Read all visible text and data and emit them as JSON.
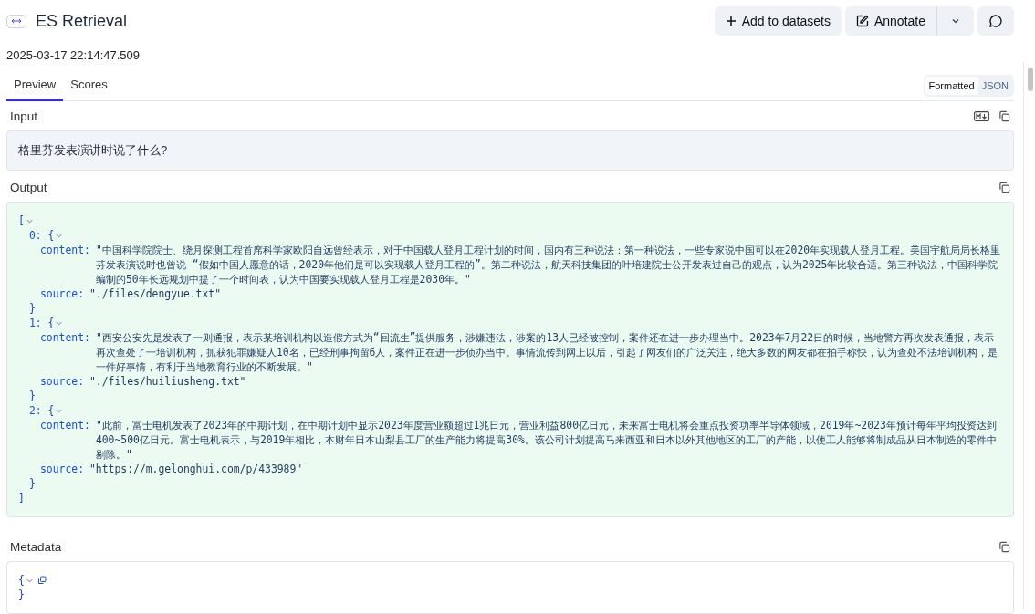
{
  "header": {
    "title": "ES Retrieval",
    "timestamp": "2025-03-17 22:14:47.509",
    "buttons": [
      {
        "kind": "add",
        "label": "Add to datasets"
      },
      {
        "kind": "annotate",
        "label": "Annotate"
      },
      {
        "kind": "dropdown"
      },
      {
        "kind": "comment"
      }
    ]
  },
  "tabs": [
    {
      "label": "Preview",
      "selected": true
    },
    {
      "label": "Scores",
      "selected": false
    }
  ],
  "view_toggle": [
    {
      "label": "Formatted",
      "selected": true
    },
    {
      "label": "JSON",
      "selected": false
    }
  ],
  "input": {
    "label": "Input",
    "text": "格里芬发表演讲时说了什么?"
  },
  "output": {
    "label": "Output",
    "open": "[",
    "close": "]",
    "items": [
      {
        "key": "0:",
        "open": "{",
        "close": "}",
        "fields": [
          {
            "key": "content:",
            "value": "\"中国科学院院士、绕月探测工程首席科学家欧阳自远曾经表示，对于中国载人登月工程计划的时间，国内有三种说法：第一种说法，一些专家说中国可以在2020年实现载人登月工程。美国宇航局局长格里芬发表演说时也曾说 “假如中国人愿意的话，2020年他们是可以实现载人登月工程的”。第二种说法，航天科技集团的叶培建院士公开发表过自己的观点，认为2025年比较合适。第三种说法，中国科学院编制的50年长远规划中提了一个时间表，认为中国要实现载人登月工程是2030年。\""
          },
          {
            "key": "source:",
            "value": "\"./files/dengyue.txt\""
          }
        ]
      },
      {
        "key": "1:",
        "open": "{",
        "close": "}",
        "fields": [
          {
            "key": "content:",
            "value": "\"西安公安先是发表了一则通报，表示某培训机构以造假方式为“回流生”提供服务，涉嫌违法，涉案的13人已经被控制，案件还在进一步办理当中。2023年7月22日的时候，当地警方再次发表通报，表示再次查处了一培训机构，抓获犯罪嫌疑人10名，已经刑事拘留6人，案件正在进一步侦办当中。事情流传到网上以后，引起了网友们的广泛关注，绝大多数的网友都在拍手称快，认为查处不法培训机构，是一件好事情，有利于当地教育行业的不断发展。\""
          },
          {
            "key": "source:",
            "value": "\"./files/huiliusheng.txt\""
          }
        ]
      },
      {
        "key": "2:",
        "open": "{",
        "close": "}",
        "fields": [
          {
            "key": "content:",
            "value": "\"此前，富士电机发表了2023年的中期计划，在中期计划中显示2023年度营业额超过1兆日元，营业利益800亿日元，未来富士电机将会重点投资功率半导体领域，2019年~2023年预计每年平均投资达到400~500亿日元。富士电机表示，与2019年相比，本财年日本山梨县工厂的生产能力将提高30%。该公司计划提高马来西亚和日本以外其他地区的工厂的产能，以使工人能够将制成品从日本制造的零件中剔除。\""
          },
          {
            "key": "source:",
            "value": "\"https://m.gelonghui.com/p/433989\""
          }
        ]
      }
    ]
  },
  "metadata": {
    "label": "Metadata",
    "open": "{",
    "close": "}"
  }
}
